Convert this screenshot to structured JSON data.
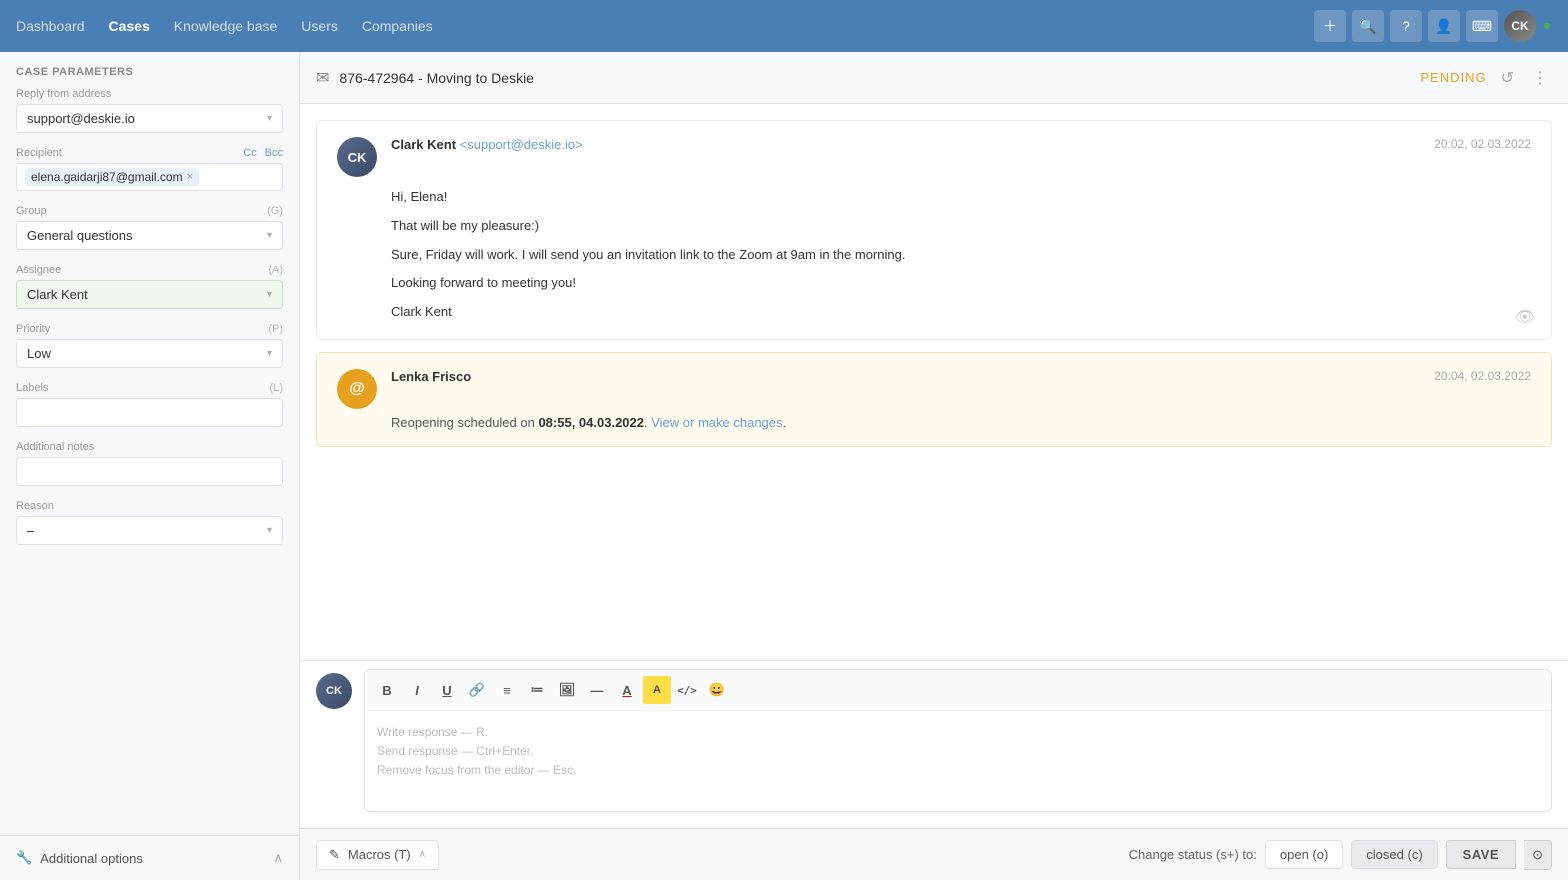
{
  "nav": {
    "items": [
      {
        "label": "Dashboard",
        "active": false
      },
      {
        "label": "Cases",
        "active": true
      },
      {
        "label": "Knowledge base",
        "active": false
      },
      {
        "label": "Users",
        "active": false
      },
      {
        "label": "Companies",
        "active": false
      }
    ],
    "icons": [
      "plus-icon",
      "search-icon",
      "help-icon",
      "person-icon",
      "grid-icon"
    ]
  },
  "left_panel": {
    "header": "Case Parameters",
    "fields": {
      "reply_from_label": "Reply from address",
      "reply_from_value": "support@deskie.io",
      "recipient_label": "Recipient",
      "recipient_cc": "Cc",
      "recipient_bcc": "Bcc",
      "recipient_value": "elena.gaidarji87@gmail.com",
      "group_label": "Group",
      "group_shortcut": "(G)",
      "group_value": "General questions",
      "assignee_label": "Assignee",
      "assignee_shortcut": "(A)",
      "assignee_value": "Clark Kent",
      "priority_label": "Priority",
      "priority_shortcut": "(P)",
      "priority_value": "Low",
      "labels_label": "Labels",
      "labels_shortcut": "(L)",
      "additional_notes_label": "Additional notes",
      "reason_label": "Reason",
      "reason_value": "–"
    },
    "footer": {
      "label": "Additional options",
      "icon": "wrench-icon"
    }
  },
  "case_header": {
    "title": "876-472964 - Moving to Deskie",
    "status": "PENDING",
    "icon": "email-icon"
  },
  "messages": [
    {
      "id": "msg1",
      "sender_name": "Clark Kent",
      "sender_email": "<support@deskie.io>",
      "time": "20:02, 02.03.2022",
      "avatar_initials": "CK",
      "body_lines": [
        "Hi, Elena!",
        "That will be my pleasure:)",
        "Sure, Friday will work. I will send you an invitation link to the Zoom at 9am in the morning.",
        "Looking forward to meeting you!",
        "Clark Kent"
      ],
      "type": "normal"
    },
    {
      "id": "msg2",
      "sender_name": "Lenka Frisco",
      "sender_email": "",
      "time": "20:04, 02.03.2022",
      "avatar_initials": "@",
      "system_text_prefix": "Reopening scheduled on ",
      "system_bold": "08:55, 04.03.2022",
      "system_link": "View or make changes",
      "type": "system"
    }
  ],
  "editor": {
    "placeholder_line1": "Write response — R.",
    "placeholder_line2": "Send response — Ctrl+Enter.",
    "placeholder_line3": "Remove focus from the editor — Esc.",
    "toolbar_buttons": [
      "B",
      "I",
      "U",
      "🔗",
      "≡",
      "≔",
      "🖼",
      "—",
      "A",
      "A",
      "</>",
      "😀"
    ]
  },
  "bottom_bar": {
    "macros_label": "Macros (T)",
    "status_label": "Change status (s+) to:",
    "open_label": "open (o)",
    "closed_label": "closed (c)",
    "save_label": "SAVE"
  }
}
